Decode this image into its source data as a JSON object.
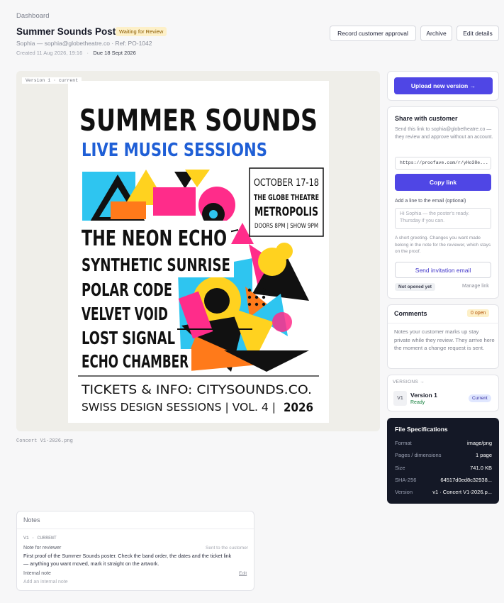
{
  "header": {
    "breadcrumb": "Dashboard",
    "title": "Summer Sounds Poster",
    "status": "Waiting for Review",
    "subtitle": "Sophia — sophia@globetheatre.co · Ref: PO-1042",
    "created": "Created 11 Aug 2026, 19:16",
    "due": "Due 18 Sept 2026",
    "actions": {
      "record": "Record customer approval",
      "archive": "Archive",
      "edit": "Edit details"
    }
  },
  "preview": {
    "version_tag": "Version 1 · current",
    "filename": "Concert V1-2026.png"
  },
  "poster": {
    "headline": "SUMMER SOUNDS",
    "subhead": "LIVE MUSIC SESSIONS",
    "date": "OCTOBER 17-18",
    "venue": "THE GLOBE THEATRE",
    "city": "METROPOLIS",
    "times": "DOORS 8PM | SHOW 9PM",
    "bands": [
      "THE NEON ECHO",
      "SYNTHETIC SUNRISE",
      "POLAR CODE",
      "VELVET VOID",
      "LOST SIGNAL",
      "ECHO CHAMBER"
    ],
    "tickets": "TICKETS & INFO:  CITYSOUNDS.CO.",
    "series": "SWISS DESIGN SESSIONS | VOL. 4 |",
    "year": "2026"
  },
  "notes": {
    "title": "Notes",
    "version_label": "V1 · CURRENT",
    "reviewer_label": "Note for reviewer",
    "sent_label": "Sent to the customer",
    "reviewer_note": "First proof of the Summer Sounds poster. Check the band order, the dates and the ticket link — anything you want moved, mark it straight on the artwork.",
    "internal_label": "Internal note",
    "edit": "Edit",
    "internal_placeholder": "Add an internal note"
  },
  "sidebar": {
    "upload": "Upload new version →",
    "share": {
      "title": "Share with customer",
      "description": "Send this link to sophia@globetheatre.co — they review and approve without an account.",
      "link": "https://proofave.com/r/yHo38e...",
      "copy": "Copy link",
      "line_label": "Add a line to the email (optional)",
      "line_placeholder": "Hi Sophia — the poster's ready. Thursday if you can.",
      "line_help": "A short greeting. Changes you want made belong in the note for the reviewer, which stays on the proof.",
      "send": "Send invitation email",
      "not_opened": "Not opened yet",
      "manage": "Manage link"
    },
    "comments": {
      "title": "Comments",
      "badge": "0 open",
      "body": "Notes your customer marks up stay private while they review. They arrive here the moment a change request is sent."
    },
    "versions": {
      "heading": "VERSIONS →",
      "tag": "V1",
      "name": "Version 1",
      "state": "Ready",
      "badge": "Current"
    },
    "specs": {
      "title": "File Specifications",
      "rows": [
        {
          "label": "Format",
          "value": "image/png"
        },
        {
          "label": "Pages / dimensions",
          "value": "1 page"
        },
        {
          "label": "Size",
          "value": "741.0 KB"
        },
        {
          "label": "SHA-256",
          "value": "64517d0ed8c32938..."
        },
        {
          "label": "Version",
          "value": "v1 · Concert V1-2026.p..."
        }
      ]
    }
  }
}
